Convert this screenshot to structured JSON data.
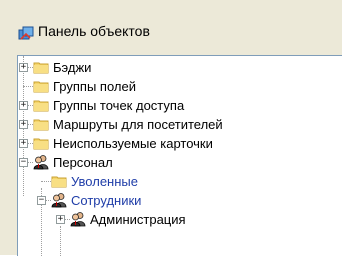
{
  "panel": {
    "title": "Панель объектов",
    "title_icon": "object-panel-icon"
  },
  "tree": {
    "items": [
      {
        "label": "Бэджи",
        "icon": "folder-icon",
        "expander": "+"
      },
      {
        "label": "Группы полей",
        "icon": "folder-icon",
        "expander": ""
      },
      {
        "label": "Группы точек доступа",
        "icon": "folder-icon",
        "expander": "+"
      },
      {
        "label": "Маршруты для посетителей",
        "icon": "folder-icon",
        "expander": "+"
      },
      {
        "label": "Неиспользуемые карточки",
        "icon": "folder-icon",
        "expander": "+"
      },
      {
        "label": "Персонал",
        "icon": "people-icon",
        "expander": "−"
      },
      {
        "label": "Уволенные",
        "icon": "folder-icon",
        "expander": ""
      },
      {
        "label": "Сотрудники",
        "icon": "people-icon",
        "expander": "−"
      },
      {
        "label": "Администрация",
        "icon": "people-icon",
        "expander": "+"
      }
    ]
  },
  "colors": {
    "folder": "#f5d56b",
    "folder_dark": "#c9a233",
    "link_blue": "#1f3da8"
  }
}
